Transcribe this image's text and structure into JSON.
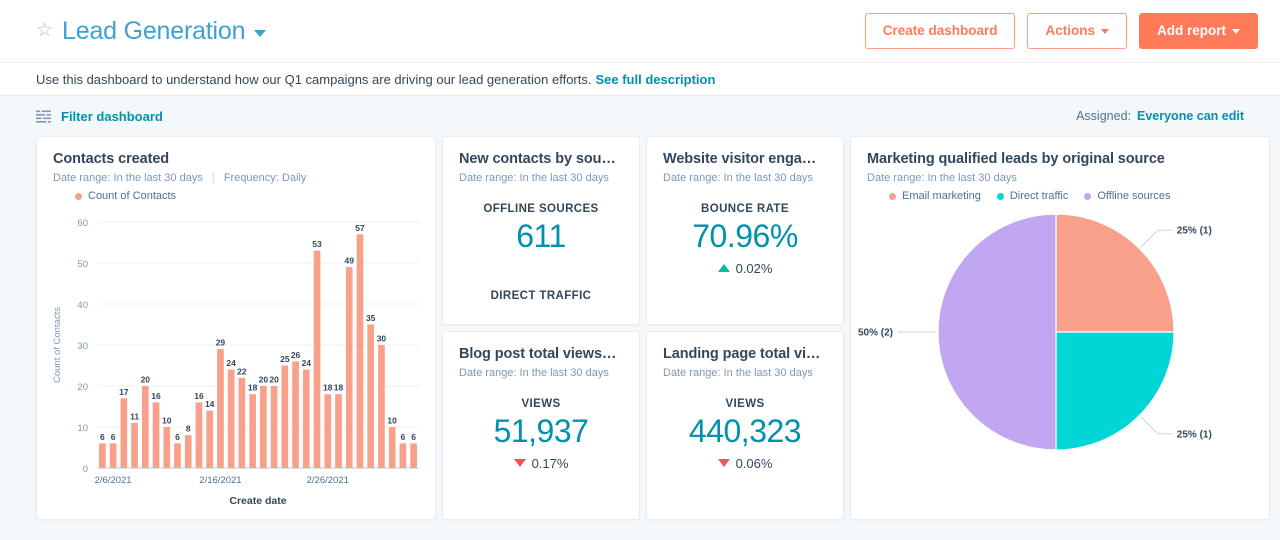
{
  "header": {
    "star_icon": "star-outline-icon",
    "title": "Lead Generation",
    "title_caret": "chevron-down-icon",
    "create_dashboard_label": "Create dashboard",
    "actions_label": "Actions",
    "add_report_label": "Add report"
  },
  "description": {
    "text": "Use this dashboard to understand how our Q1 campaigns are driving our lead generation efforts.",
    "link_label": "See full description"
  },
  "filter_bar": {
    "filter_icon": "filter-lines-icon",
    "filter_label": "Filter dashboard",
    "assigned_label": "Assigned:",
    "assigned_value": "Everyone can edit"
  },
  "colors": {
    "coral": "#F8A08A",
    "teal": "#00D6D6",
    "purple": "#C1A6F2",
    "accent_blue": "#0091ae",
    "primary_orange": "#ff7a59",
    "link_blue": "#3ca2d4",
    "positive": "#00bda5",
    "negative": "#f2545b"
  },
  "cards": {
    "contacts_created": {
      "title": "Contacts created",
      "date_range": "Date range: In the last 30 days",
      "frequency": "Frequency: Daily",
      "legend": [
        {
          "label": "Count of Contacts",
          "color": "#F8A08A"
        }
      ]
    },
    "new_contacts_by_source": {
      "title": "New contacts by sou…",
      "date_range": "Date range: In the last 30 days",
      "metric_label": "OFFLINE SOURCES",
      "metric_value": "611",
      "footer_label": "DIRECT TRAFFIC"
    },
    "website_visitor_engagement": {
      "title": "Website visitor enga…",
      "date_range": "Date range: In the last 30 days",
      "metric_label": "BOUNCE RATE",
      "metric_value": "70.96%",
      "delta_direction": "up",
      "delta_value": "0.02%"
    },
    "blog_post_total_views": {
      "title": "Blog post total views…",
      "date_range": "Date range: In the last 30 days",
      "metric_label": "VIEWS",
      "metric_value": "51,937",
      "delta_direction": "down",
      "delta_value": "0.17%"
    },
    "landing_page_total_views": {
      "title": "Landing page total vi…",
      "date_range": "Date range: In the last 30 days",
      "metric_label": "VIEWS",
      "metric_value": "440,323",
      "delta_direction": "down",
      "delta_value": "0.06%"
    },
    "mql_by_source": {
      "title": "Marketing qualified leads by original source",
      "date_range": "Date range: In the last 30 days",
      "legend": [
        {
          "label": "Email marketing",
          "color": "#F8A08A"
        },
        {
          "label": "Direct traffic",
          "color": "#00D6D6"
        },
        {
          "label": "Offline sources",
          "color": "#C1A6F2"
        }
      ]
    }
  },
  "chart_data": [
    {
      "type": "bar",
      "title": "Contacts created",
      "xlabel": "Create date",
      "ylabel": "Count of Contacts",
      "ylim": [
        0,
        60
      ],
      "yticks": [
        0,
        10,
        20,
        30,
        40,
        50,
        60
      ],
      "grid": true,
      "legend_position": "top-left",
      "series_name": "Count of Contacts",
      "color": "#F8A08A",
      "xtick_labels": [
        "2/6/2021",
        "2/16/2021",
        "2/26/2021"
      ],
      "xtick_indices": [
        1,
        11,
        21
      ],
      "categories": [
        "2/5/2021",
        "2/6/2021",
        "2/7/2021",
        "2/8/2021",
        "2/9/2021",
        "2/10/2021",
        "2/11/2021",
        "2/12/2021",
        "2/13/2021",
        "2/14/2021",
        "2/15/2021",
        "2/16/2021",
        "2/17/2021",
        "2/18/2021",
        "2/19/2021",
        "2/20/2021",
        "2/21/2021",
        "2/22/2021",
        "2/23/2021",
        "2/24/2021",
        "2/25/2021",
        "2/26/2021",
        "2/27/2021",
        "2/28/2021",
        "3/1/2021",
        "3/2/2021",
        "3/3/2021",
        "3/4/2021",
        "3/5/2021",
        "3/6/2021"
      ],
      "values": [
        6,
        6,
        17,
        11,
        20,
        16,
        10,
        6,
        8,
        16,
        14,
        29,
        24,
        22,
        18,
        20,
        20,
        25,
        26,
        24,
        53,
        18,
        18,
        49,
        57,
        35,
        30,
        10,
        6,
        6
      ]
    },
    {
      "type": "pie",
      "title": "Marketing qualified leads by original source",
      "legend_position": "top",
      "labels": [
        "Email marketing",
        "Direct traffic",
        "Offline sources"
      ],
      "values": [
        1,
        1,
        2
      ],
      "percents": [
        25,
        25,
        50
      ],
      "colors": [
        "#F8A08A",
        "#00D6D6",
        "#C1A6F2"
      ],
      "data_labels": [
        "25% (1)",
        "25% (1)",
        "50% (2)"
      ]
    }
  ]
}
